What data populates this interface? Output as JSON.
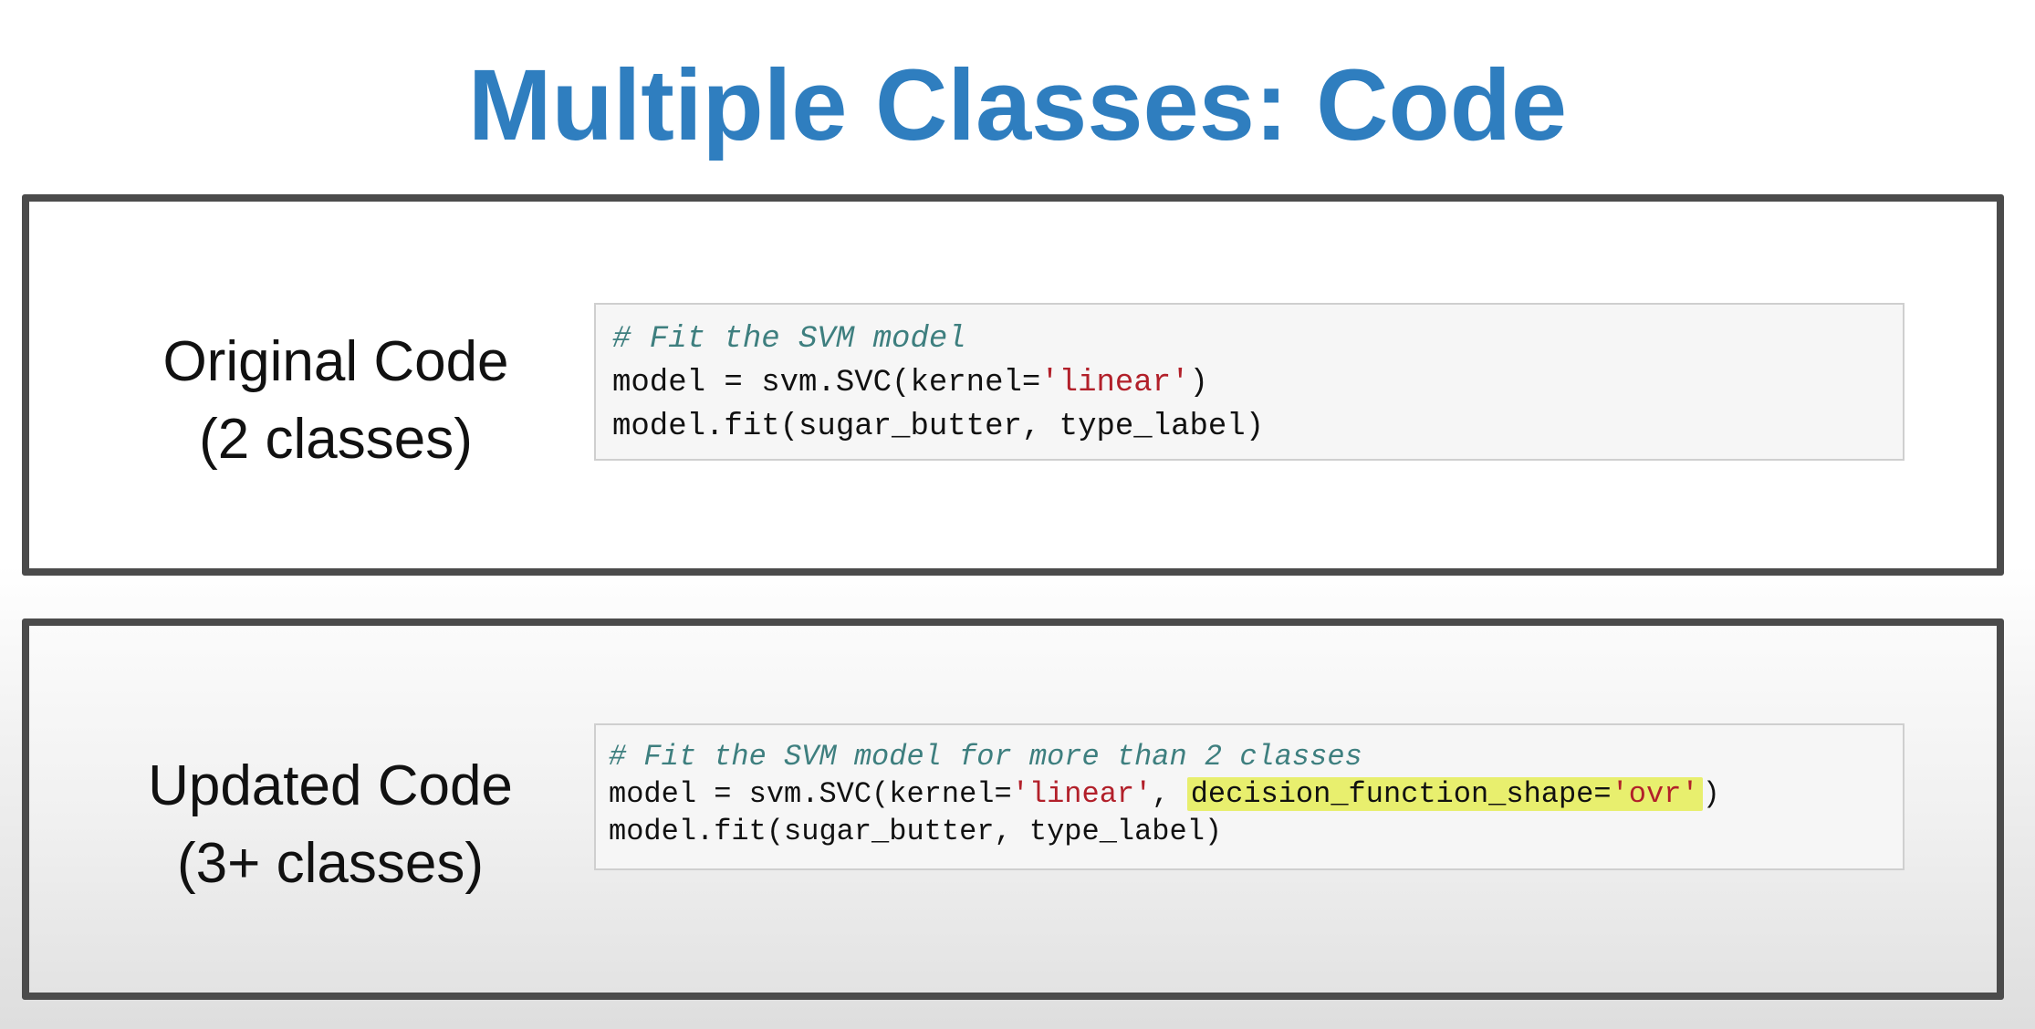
{
  "title": "Multiple Classes: Code",
  "colors": {
    "title": "#2f7ebf",
    "border": "#4b4b4b",
    "comment": "#3e7f7f",
    "string": "#b2202a",
    "highlight": "#e8ef6e"
  },
  "original": {
    "label_line1": "Original Code",
    "label_line2": "(2 classes)",
    "code": {
      "comment": "# Fit the SVM model",
      "line2_prefix": "model = svm.SVC(kernel=",
      "line2_string": "'linear'",
      "line2_suffix": ")",
      "line3": "model.fit(sugar_butter, type_label)"
    }
  },
  "updated": {
    "label_line1": "Updated Code",
    "label_line2": "(3+ classes)",
    "code": {
      "comment": "# Fit the SVM model for more than 2 classes",
      "line2_prefix": "model = svm.SVC(kernel=",
      "line2_string": "'linear'",
      "line2_sep": ", ",
      "line2_hl_key": "decision_function_shape=",
      "line2_hl_value": "'ovr'",
      "line2_suffix": ")",
      "line3": "model.fit(sugar_butter, type_label)"
    }
  }
}
